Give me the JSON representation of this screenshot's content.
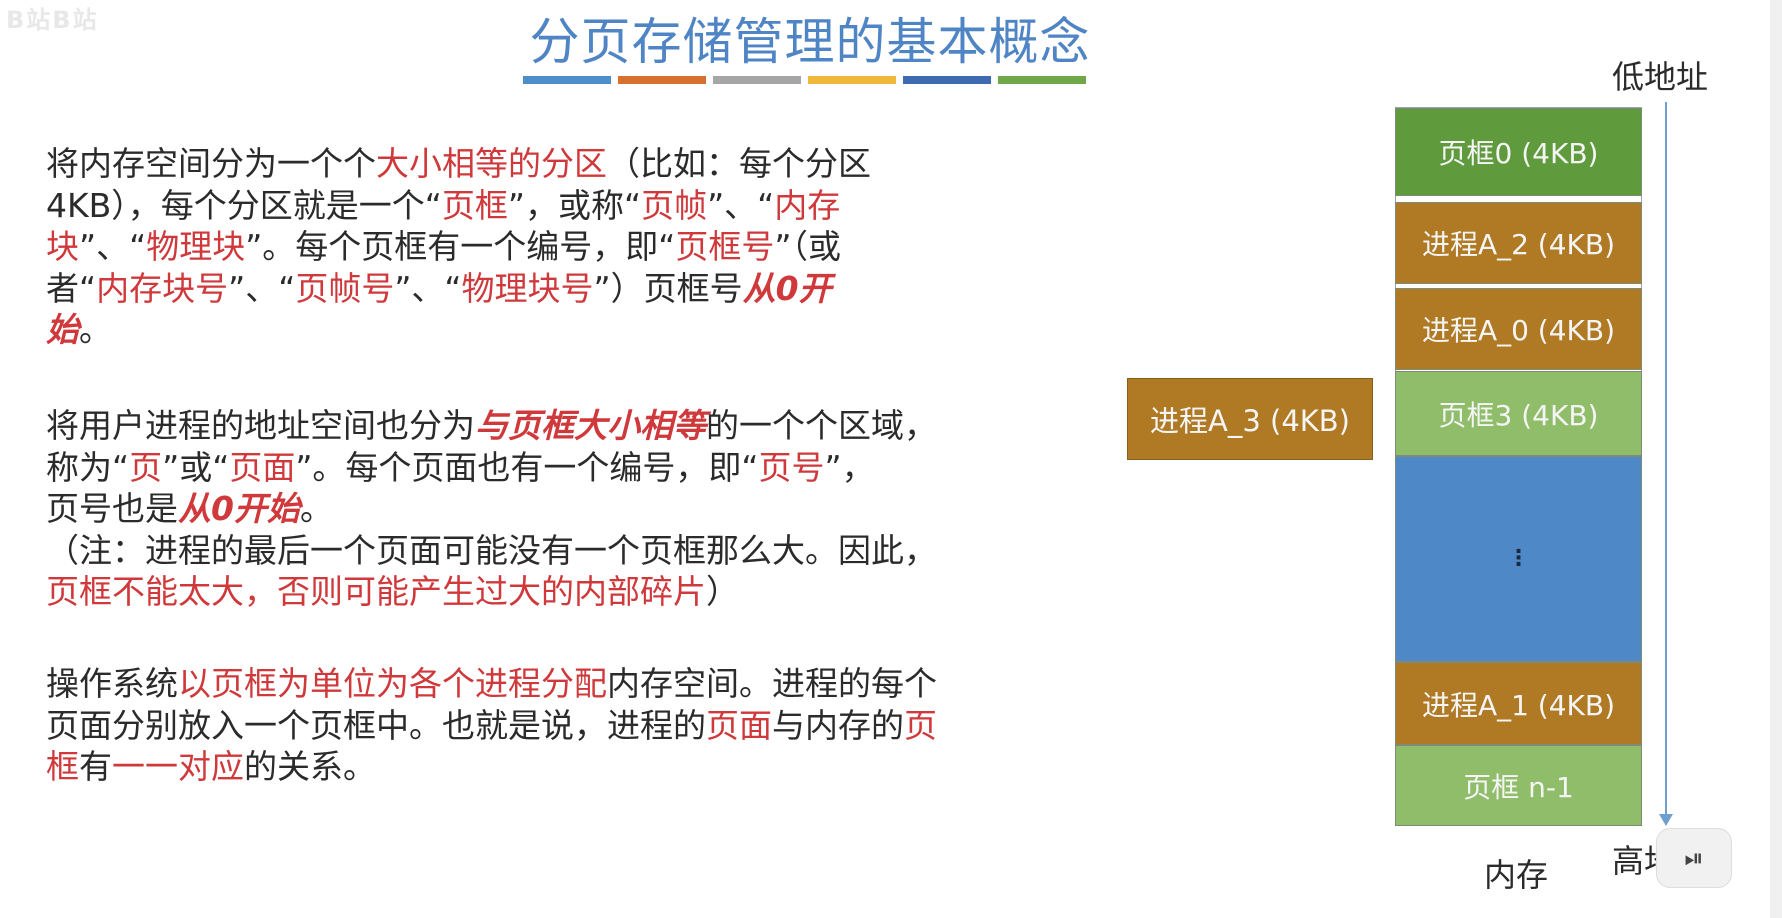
{
  "corner_logo": "B站B站",
  "title": "分页存储管理的基本概念",
  "title_bar_colors": [
    "#4f8fc9",
    "#d9702f",
    "#a6a6a6",
    "#eeb93b",
    "#3e6bb0",
    "#6ea84a"
  ],
  "para1": {
    "s1": "将内存空间分为一个个",
    "s2": "大小相等的分区",
    "s3": "（比如：每个分区",
    "s4": "4KB），每个分区就是一个“",
    "s5": "页框",
    "s6": "”，或称“",
    "s7": "页帧",
    "s8": "”、“",
    "s9": "内存",
    "s10": "块",
    "s11": "”、“",
    "s12": "物理块",
    "s13": "”。每个页框有一个编号，即“",
    "s14": "页框号",
    "s15": "”（或",
    "s16": "者“",
    "s17": "内存块号",
    "s18": "”、“",
    "s19": "页帧号",
    "s20": "”、“",
    "s21": "物理块号",
    "s22": "”）页框号",
    "s23": "从0开",
    "s24": "始",
    "s25": "。"
  },
  "para2": {
    "s1": "将用户进程的地址空间也分为",
    "s2": "与页框大小相等",
    "s3": "的一个个区域，",
    "s4": "称为“",
    "s5": "页",
    "s6": "”或“",
    "s7": "页面",
    "s8": "”。每个页面也有一个编号，即“",
    "s9": "页号",
    "s10": "”，",
    "s11": "页号也是",
    "s12": "从0开始",
    "s13": "。",
    "s14": "（注：进程的最后一个页面可能没有一个页框那么大。因此，",
    "s15": "页框不能太大，否则可能产生过大的内部碎片",
    "s16": "）"
  },
  "para3": {
    "s1": "操作系统",
    "s2": "以页框为单位为各个进程分配",
    "s3": "内存空间。进程的每个",
    "s4": "页面分别放入一个页框中。也就是说，进程的",
    "s5": "页面",
    "s6": "与内存的",
    "s7": "页",
    "s8": "框",
    "s9": "有",
    "s10": "一一对应",
    "s11": "的关系。"
  },
  "memory": {
    "blocks": [
      {
        "label": "页框0 (4KB)",
        "color": "#5f9b3d"
      },
      {
        "label": "进程A_2 (4KB)",
        "color": "#b07a25"
      },
      {
        "label": "进程A_0 (4KB)",
        "color": "#b07a25"
      },
      {
        "label": "页框3 (4KB)",
        "color": "#8fbd6a"
      },
      {
        "label": "",
        "color": "#4f88c6"
      },
      {
        "label": "进程A_1 (4KB)",
        "color": "#b07a25"
      },
      {
        "label": "页框 n-1",
        "color": "#8fbd6a"
      }
    ],
    "dots": "⋮",
    "caption": "内存"
  },
  "outside_block": {
    "label": "进程A_3 (4KB)",
    "color": "#b07a25"
  },
  "address": {
    "low": "低地址",
    "high": "高地址"
  },
  "play_button_icon": "play-pause-icon",
  "play_button_glyph": "⏯"
}
